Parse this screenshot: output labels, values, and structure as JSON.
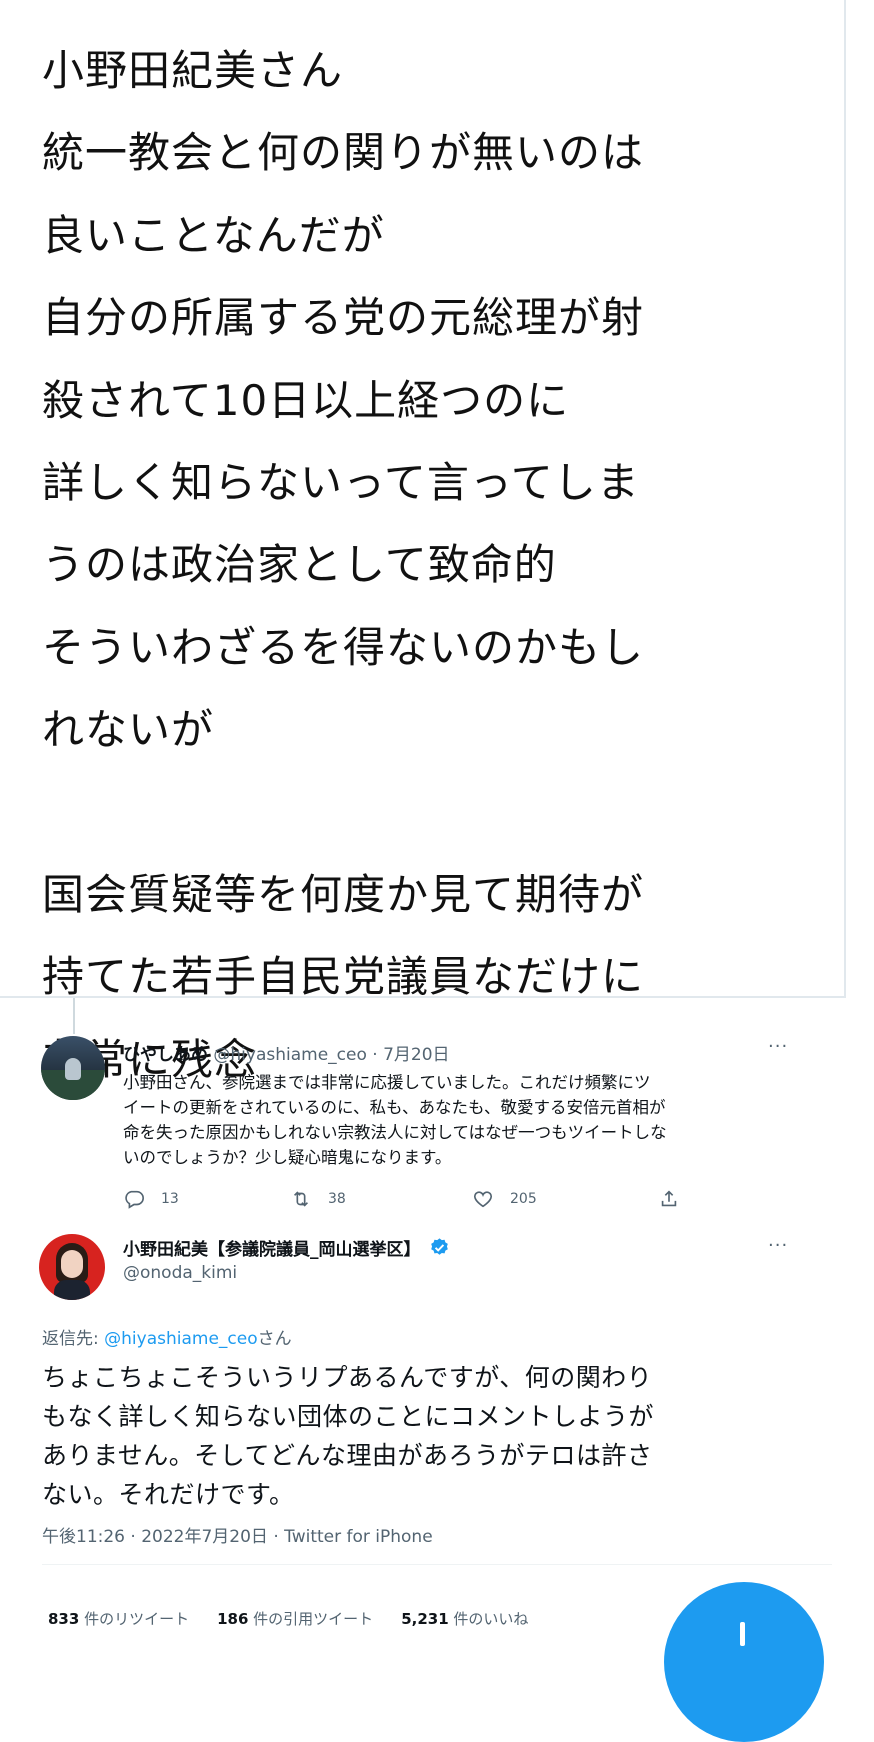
{
  "quote_text": {
    "lines": [
      "小野田紀美さん",
      "統一教会と何の関りが無いのは",
      "良いことなんだが",
      "自分の所属する党の元総理が射",
      "殺されて10日以上経つのに",
      "詳しく知らないって言ってしま",
      "うのは政治家として致命的",
      "そういわざるを得ないのかもし",
      "れないが",
      "",
      "国会質疑等を何度か見て期待が",
      "持てた若手自民党議員なだけに",
      "非常に残念"
    ]
  },
  "reply_tweet": {
    "display_name": "ひやしあめ",
    "handle": "@hiyashiame_ceo",
    "date": "· 7月20日",
    "more_label": "···",
    "body_lines": [
      "小野田さん、参院選までは非常に応援していました。これだけ頻繁にツ",
      "イートの更新をされているのに、私も、あなたも、敬愛する安倍元首相が",
      "命を失った原因かもしれない宗教法人に対してはなぜ一つもツイートしな",
      "いのでしょうか？少し疑心暗鬼になります。"
    ],
    "reply_count": "13",
    "retweet_count": "38",
    "like_count": "205"
  },
  "main_tweet": {
    "display_name": "小野田紀美【参議院議員_岡山選挙区】",
    "handle": "@onoda_kimi",
    "more_label": "···",
    "reply_to_prefix": "返信先: ",
    "reply_to_handle": "@hiyashiame_ceo",
    "reply_to_suffix": "さん",
    "body_lines": [
      "ちょこちょこそういうリプあるんですが、何の関わり",
      "もなく詳しく知らない団体のことにコメントしようが",
      "ありません。そしてどんな理由があろうがテロは許さ",
      "ない。それだけです。"
    ],
    "timestamp": "午後11:26 · 2022年7月20日 · Twitter for iPhone",
    "stats": {
      "retweets_value": "833",
      "retweets_label": " 件のリツイート",
      "quotes_value": "186",
      "quotes_label": " 件の引用ツイート",
      "likes_value": "5,231",
      "likes_label": " 件のいいね"
    }
  },
  "colors": {
    "accent": "#1d9bf0",
    "muted_text": "#536471",
    "border": "#e1e8ed"
  },
  "icons": [
    "reply-icon",
    "retweet-icon",
    "like-icon",
    "share-icon",
    "verified-badge-icon",
    "more-icon",
    "compose-fab"
  ]
}
